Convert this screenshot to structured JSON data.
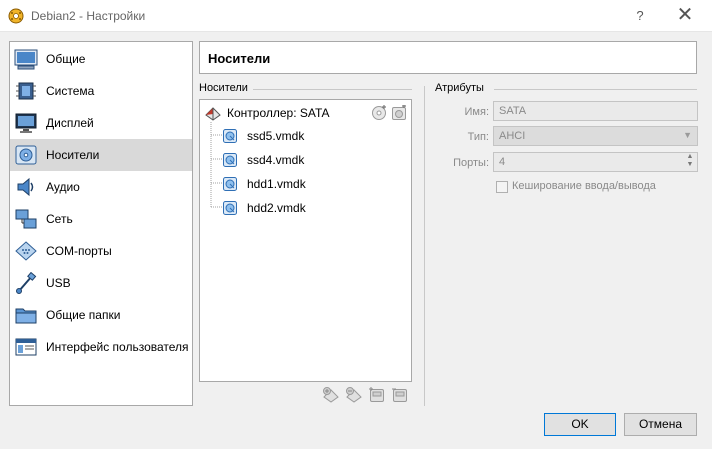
{
  "window": {
    "title": "Debian2 - Настройки",
    "help_label": "?",
    "close_label": "✕"
  },
  "sidebar": {
    "items": [
      {
        "label": "Общие",
        "icon": "general-icon"
      },
      {
        "label": "Система",
        "icon": "system-chip-icon"
      },
      {
        "label": "Дисплей",
        "icon": "display-monitor-icon"
      },
      {
        "label": "Носители",
        "icon": "storage-disk-icon",
        "selected": true
      },
      {
        "label": "Аудио",
        "icon": "audio-speaker-icon"
      },
      {
        "label": "Сеть",
        "icon": "network-icon"
      },
      {
        "label": "COM-порты",
        "icon": "serial-port-icon"
      },
      {
        "label": "USB",
        "icon": "usb-icon"
      },
      {
        "label": "Общие папки",
        "icon": "shared-folder-icon"
      },
      {
        "label": "Интерфейс пользователя",
        "icon": "user-interface-icon"
      }
    ]
  },
  "header": {
    "title": "Носители"
  },
  "storage": {
    "group_label": "Носители",
    "controller": {
      "label": "Контроллер: SATA",
      "icon": "sata-controller-icon"
    },
    "disks": [
      {
        "label": "ssd5.vmdk",
        "icon": "hard-disk-icon"
      },
      {
        "label": "ssd4.vmdk",
        "icon": "hard-disk-icon"
      },
      {
        "label": "hdd1.vmdk",
        "icon": "hard-disk-icon"
      },
      {
        "label": "hdd2.vmdk",
        "icon": "hard-disk-icon"
      }
    ]
  },
  "attributes": {
    "group_label": "Атрибуты",
    "name_label": "Имя:",
    "name_value": "SATA",
    "type_label": "Тип:",
    "type_value": "AHCI",
    "ports_label": "Порты:",
    "ports_value": "4",
    "cache_label": "Кеширование ввода/вывода",
    "cache_checked": false
  },
  "buttons": {
    "ok": "OK",
    "cancel": "Отмена"
  }
}
